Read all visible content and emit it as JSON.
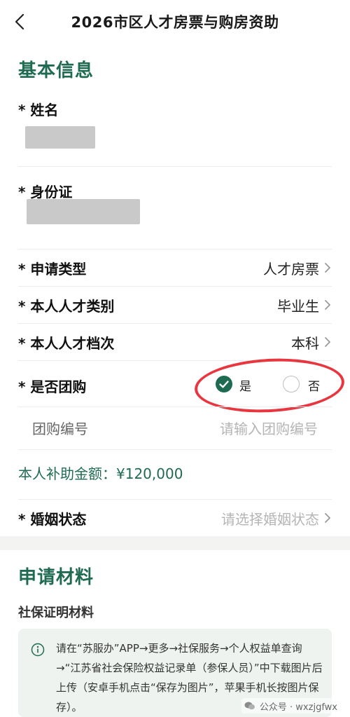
{
  "header": {
    "title": "2026市区人才房票与购房资助"
  },
  "basic_info": {
    "section_title": "基本信息",
    "name_label": "* 姓名",
    "id_label": "* 身份证",
    "apply_type": {
      "label": "* 申请类型",
      "value": "人才房票"
    },
    "talent_category": {
      "label": "* 本人人才类别",
      "value": "毕业生"
    },
    "talent_level": {
      "label": "* 本人人才档次",
      "value": "本科"
    },
    "group_purchase": {
      "label": "* 是否团购",
      "yes": "是",
      "no": "否",
      "selected": "是"
    },
    "group_number": {
      "label": "团购编号",
      "placeholder": "请输入团购编号"
    },
    "subsidy": "本人补助金额：¥120,000",
    "marital": {
      "label": "* 婚姻状态",
      "placeholder": "请选择婚姻状态"
    }
  },
  "materials": {
    "section_title": "申请材料",
    "social_security_heading": "社保证明材料",
    "info_text": "请在“苏服办”APP→更多→社保服务→个人权益单查询→“江苏省社会保险权益记录单（参保人员）”中下载图片后上传（安卓手机点击“保存为图片”，苹果手机长按图片保存）。"
  },
  "watermark": {
    "text": "公众号 · wxzjgfwx"
  },
  "colors": {
    "accent": "#1f6b52",
    "annotation": "#e8363f"
  },
  "icons": {
    "back": "chevron-left-icon",
    "row_arrow": "chevron-right-icon",
    "info": "info-icon",
    "check": "check-icon",
    "watermark": "wechat-icon"
  }
}
